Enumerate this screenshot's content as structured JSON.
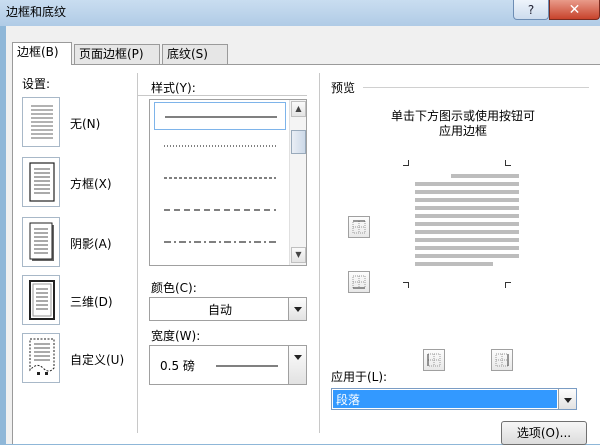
{
  "window": {
    "title": "边框和底纹",
    "help_label": "?",
    "close_label": "✕"
  },
  "tabs": [
    {
      "label": "边框(B)"
    },
    {
      "label": "页面边框(P)"
    },
    {
      "label": "底纹(S)"
    }
  ],
  "settings": {
    "label": "设置:",
    "items": [
      {
        "label": "无(N)",
        "icon": "border-none-icon"
      },
      {
        "label": "方框(X)",
        "icon": "border-box-icon"
      },
      {
        "label": "阴影(A)",
        "icon": "border-shadow-icon"
      },
      {
        "label": "三维(D)",
        "icon": "border-3d-icon"
      },
      {
        "label": "自定义(U)",
        "icon": "border-custom-icon"
      }
    ]
  },
  "style": {
    "label": "样式(Y):"
  },
  "color": {
    "label": "颜色(C):",
    "value": "自动"
  },
  "width": {
    "label": "宽度(W):",
    "value": "0.5 磅"
  },
  "preview": {
    "label": "预览",
    "instructions_line1": "单击下方图示或使用按钮可",
    "instructions_line2": "应用边框"
  },
  "apply_to": {
    "label": "应用于(L):",
    "value": "段落"
  },
  "options_button": "选项(O)...",
  "colors": {
    "selection": "#3399ff",
    "accent": "#7eb4ea"
  }
}
